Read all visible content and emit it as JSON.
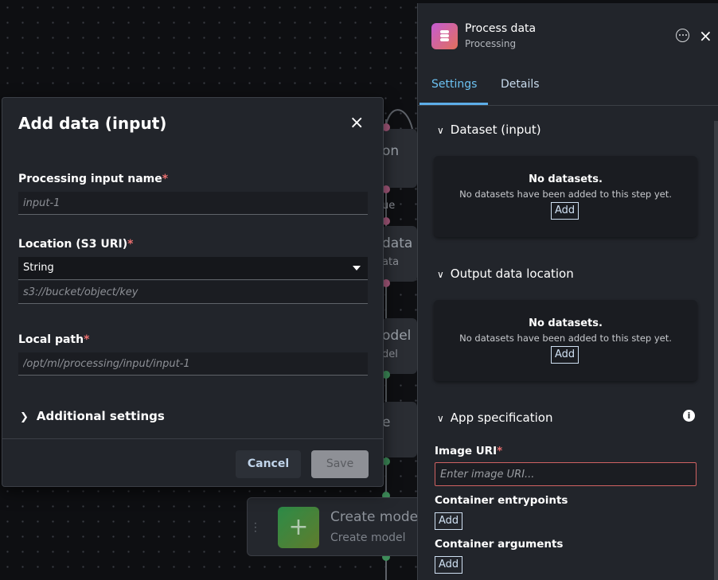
{
  "canvas": {
    "nodes": [
      {
        "title": "on",
        "sub": ""
      },
      {
        "title": "",
        "sub": "ue"
      },
      {
        "title": "data",
        "sub": "ata"
      },
      {
        "title": "odel",
        "sub": "del"
      },
      {
        "title": "e",
        "sub": ""
      }
    ],
    "bottom_node": {
      "title": "Create model",
      "subtitle": "Create model",
      "icon": "plus-icon"
    }
  },
  "modal": {
    "title": "Add data (input)",
    "close_icon": "×",
    "fields": {
      "input_name": {
        "label": "Processing input name",
        "required": "*",
        "placeholder": "input-1",
        "value": ""
      },
      "location": {
        "label": "Location (S3 URI)",
        "required": "*",
        "type_value": "String",
        "placeholder": "s3://bucket/object/key",
        "value": ""
      },
      "local_path": {
        "label": "Local path",
        "required": "*",
        "placeholder": "/opt/ml/processing/input/input-1",
        "value": ""
      }
    },
    "additional_settings": "Additional settings",
    "cancel_label": "Cancel",
    "save_label": "Save"
  },
  "panel": {
    "title": "Process data",
    "subtitle": "Processing",
    "close_icon": "×",
    "tabs": [
      {
        "label": "Settings",
        "active": true
      },
      {
        "label": "Details",
        "active": false
      }
    ],
    "sections": {
      "dataset": {
        "title": "Dataset (input)",
        "empty_title": "No datasets.",
        "empty_desc": "No datasets have been added to this step yet.",
        "add_label": "Add"
      },
      "output": {
        "title": "Output data location",
        "empty_title": "No datasets.",
        "empty_desc": "No datasets have been added to this step yet.",
        "add_label": "Add"
      },
      "app_spec": {
        "title": "App specification",
        "info_icon": "i",
        "image_uri": {
          "label": "Image URI",
          "required": "*",
          "placeholder": "Enter image URI...",
          "value": ""
        },
        "entrypoints": {
          "label": "Container entrypoints",
          "add_label": "Add"
        },
        "arguments": {
          "label": "Container arguments",
          "add_label": "Add"
        }
      }
    }
  },
  "colors": {
    "accent": "#6cc2f2",
    "required": "#eb6f6f",
    "error_border": "#d06262",
    "panel_bg": "#22252b"
  }
}
